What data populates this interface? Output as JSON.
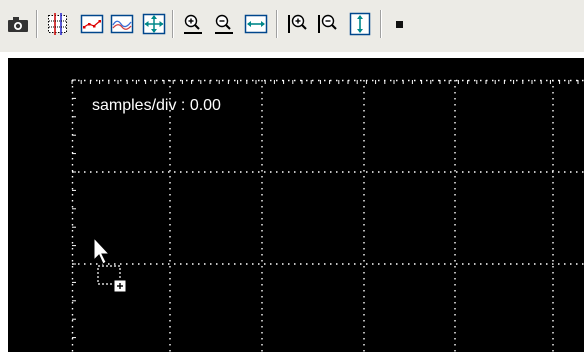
{
  "toolbar": {
    "buttons": [
      {
        "name": "screenshot-icon"
      },
      {
        "name": "select-points-icon"
      },
      {
        "name": "show-points-icon"
      },
      {
        "name": "show-waveform-icon"
      },
      {
        "name": "autoscale-icon"
      },
      {
        "name": "zoom-in-horizontal-icon"
      },
      {
        "name": "zoom-out-horizontal-icon"
      },
      {
        "name": "fit-horizontal-icon"
      },
      {
        "name": "zoom-in-vertical-icon"
      },
      {
        "name": "zoom-out-vertical-icon"
      },
      {
        "name": "fit-vertical-icon"
      },
      {
        "name": "stop-icon"
      }
    ]
  },
  "scope": {
    "background_color": "#000000",
    "grid_color": "#ffffff",
    "overlay_label": "samples/div : 0.00"
  },
  "cursor": {
    "name": "drag-copy-cursor-icon"
  }
}
